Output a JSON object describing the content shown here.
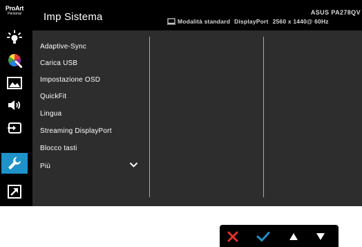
{
  "sidebar": {
    "logo_line1": "ProArt",
    "logo_line2": "Personal",
    "items": [
      {
        "icon": "brightness-icon"
      },
      {
        "icon": "color-wheel-icon"
      },
      {
        "icon": "image-icon"
      },
      {
        "icon": "sound-icon"
      },
      {
        "icon": "input-select-icon"
      },
      {
        "icon": "wrench-icon",
        "active": true
      },
      {
        "icon": "shortcut-icon"
      }
    ],
    "active_color": "#1e92c9"
  },
  "header": {
    "title": "Imp Sistema",
    "model": "ASUS PA278QV",
    "mode": "Modalità standard",
    "input": "DisplayPort",
    "resolution": "2560 x 1440@  60Hz"
  },
  "menu": {
    "items": [
      "Adaptive-Sync",
      "Carica USB",
      "Impostazione OSD",
      "QuickFit",
      "Lingua",
      "Streaming DisplayPort",
      "Blocco tasti",
      "Più"
    ],
    "more_icon": "chevron-down-icon"
  },
  "controls": {
    "buttons": [
      {
        "name": "exit-button",
        "icon": "cross-icon",
        "color": "#e5322d"
      },
      {
        "name": "confirm-button",
        "icon": "check-icon",
        "color": "#1e92c9"
      },
      {
        "name": "up-button",
        "icon": "triangle-up-icon",
        "color": "#ffffff"
      },
      {
        "name": "down-button",
        "icon": "triangle-down-icon",
        "color": "#ffffff"
      }
    ]
  }
}
